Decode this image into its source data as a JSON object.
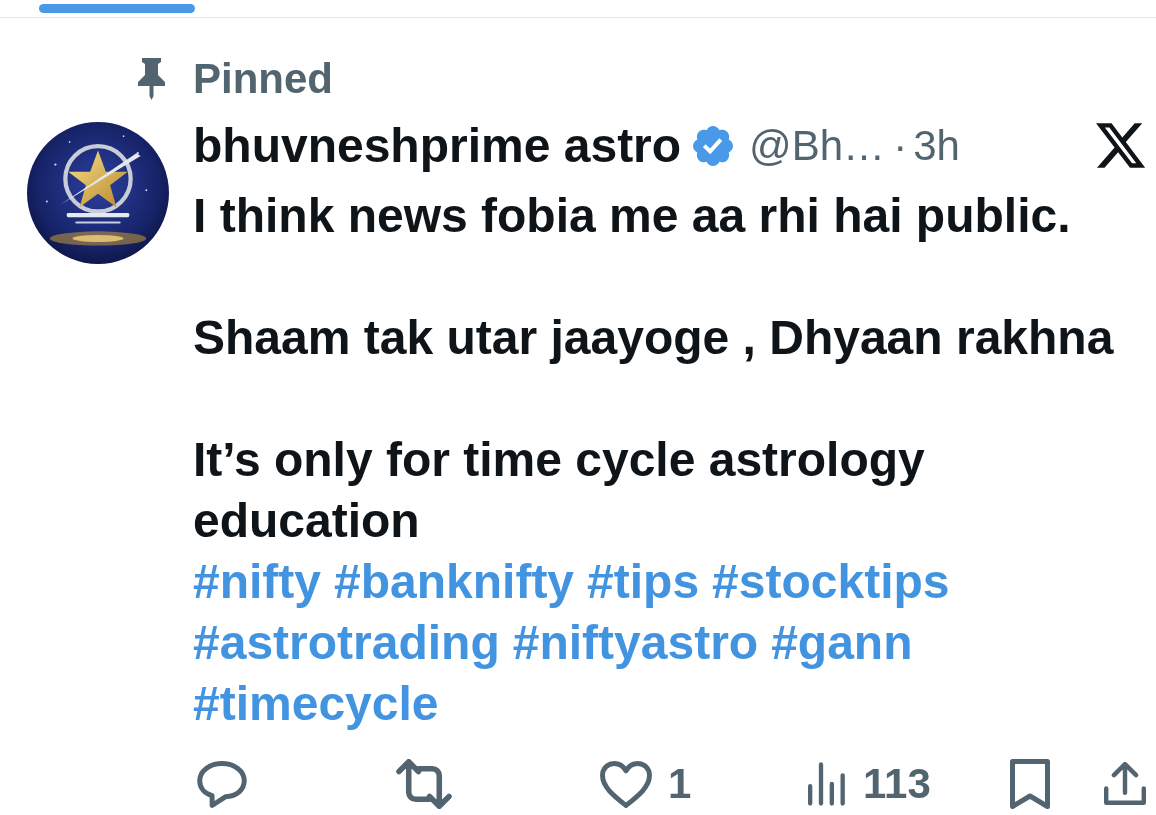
{
  "pinned": {
    "label": "Pinned"
  },
  "post": {
    "author": {
      "name": "bhuvneshprime astro",
      "verified": true,
      "handle": "@Bh…",
      "separator": "·",
      "time": "3h"
    },
    "paragraphs": [
      "I think news fobia me aa rhi hai public.",
      "Shaam tak utar jaayoge , Dhyaan rakhna",
      "It’s only for time cycle astrology education"
    ],
    "hashtags": [
      "#nifty",
      "#banknifty",
      "#tips",
      "#stocktips",
      "#astrotrading",
      "#niftyastro",
      "#gann",
      "#timecycle"
    ],
    "actions": [
      {
        "kind": "reply"
      },
      {
        "kind": "repost"
      },
      {
        "kind": "like",
        "count": "1"
      },
      {
        "kind": "views",
        "count": "113"
      },
      {
        "kind": "bookmark"
      },
      {
        "kind": "share"
      }
    ]
  }
}
